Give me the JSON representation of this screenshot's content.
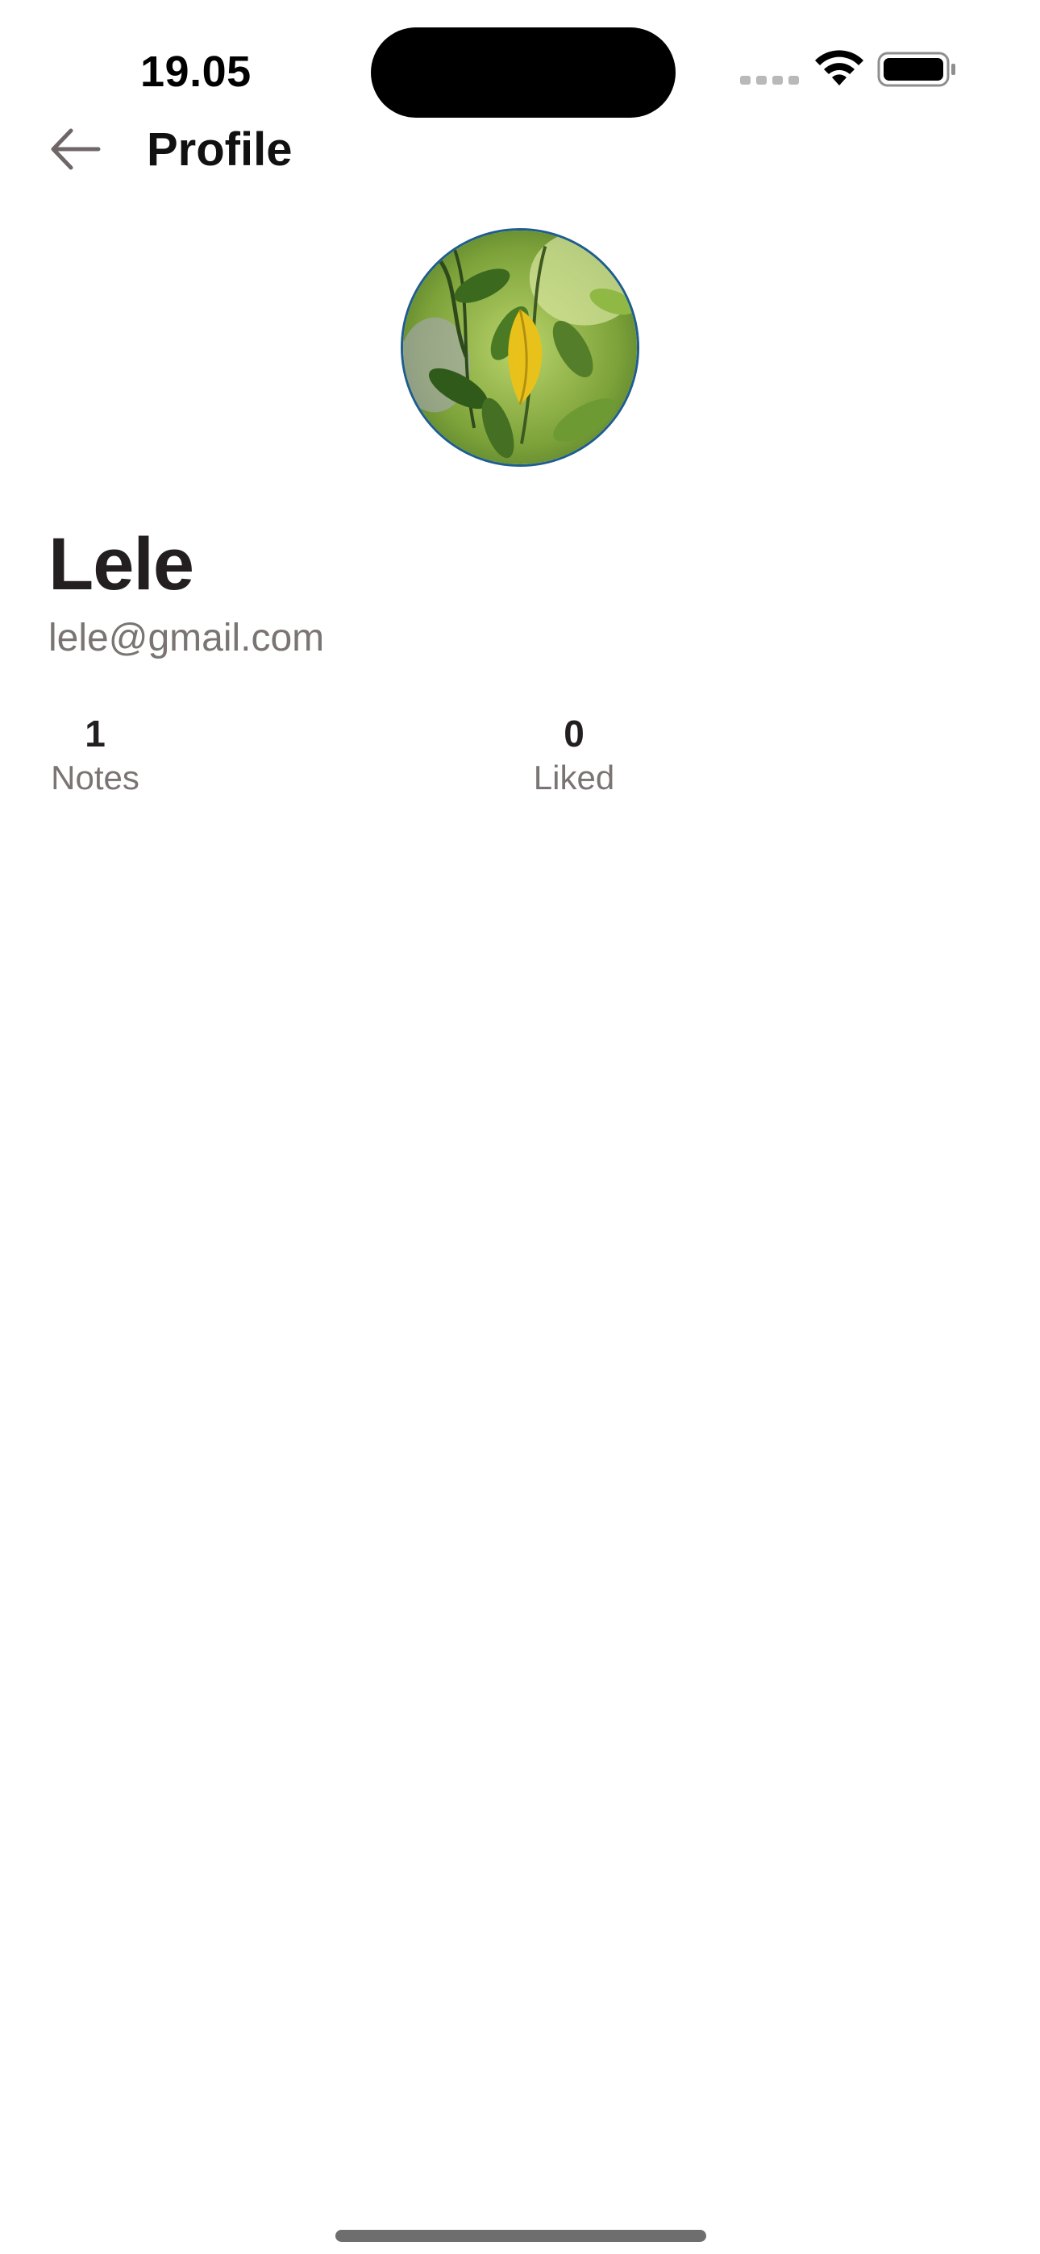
{
  "status_bar": {
    "time": "19.05",
    "icons": [
      "cellular-signal-icon",
      "wifi-icon",
      "battery-icon"
    ]
  },
  "header": {
    "back_icon": "arrow-left-icon",
    "title": "Profile"
  },
  "profile": {
    "avatar": "avatar",
    "name": "Lele",
    "email": "lele@gmail.com"
  },
  "stats": [
    {
      "value": "1",
      "label": "Notes"
    },
    {
      "value": "0",
      "label": "Liked"
    }
  ],
  "colors": {
    "text_primary": "#231f20",
    "text_secondary": "#7a7473",
    "avatar_border": "#1f5d8c",
    "background": "#ffffff"
  }
}
